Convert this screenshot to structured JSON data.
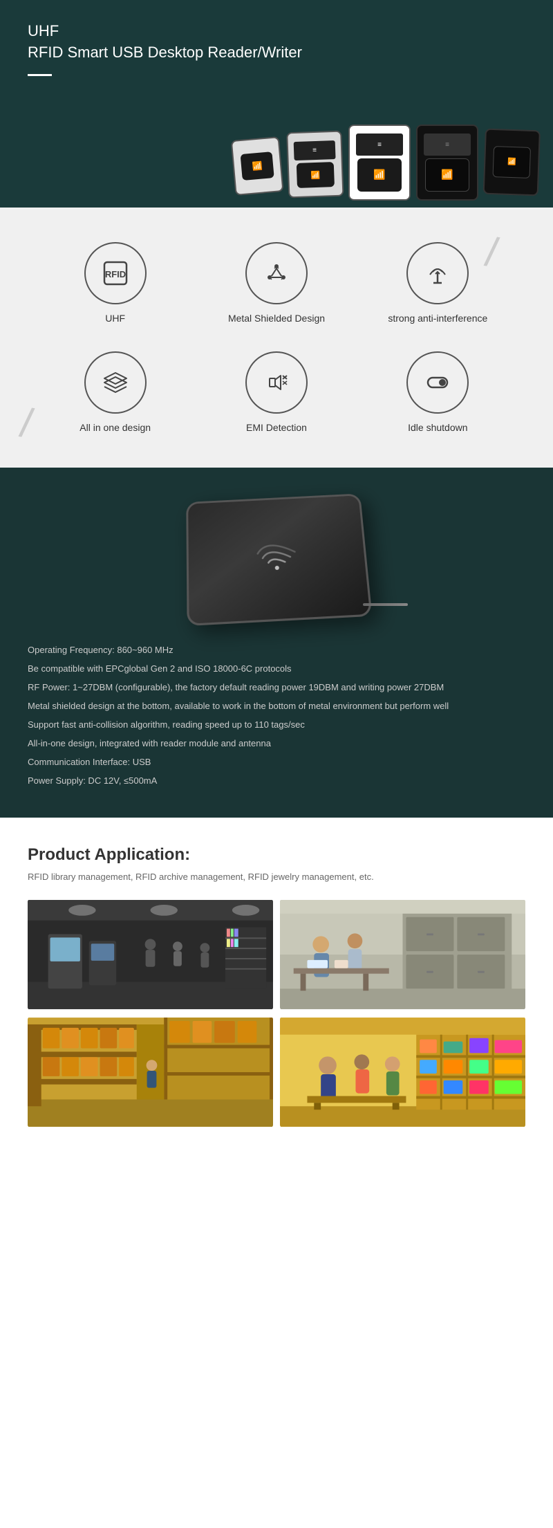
{
  "header": {
    "line1": "UHF",
    "line2": "RFID Smart USB Desktop Reader/Writer"
  },
  "features": {
    "row1": [
      {
        "id": "uhf",
        "label": "UHF",
        "icon": "rfid"
      },
      {
        "id": "metal-shield",
        "label": "Metal Shielded Design",
        "icon": "shield"
      },
      {
        "id": "anti-interference",
        "label": "strong anti-interference",
        "icon": "antenna"
      }
    ],
    "row2": [
      {
        "id": "all-in-one",
        "label": "All in one design",
        "icon": "layers"
      },
      {
        "id": "emi",
        "label": "EMI Detection",
        "icon": "emi"
      },
      {
        "id": "idle-shutdown",
        "label": "Idle shutdown",
        "icon": "toggle"
      }
    ]
  },
  "specs": {
    "items": [
      "Operating Frequency: 860~960 MHz",
      "Be compatible with EPCglobal Gen 2 and ISO 18000-6C protocols",
      "RF Power: 1~27DBM (configurable), the factory default reading power 19DBM and writing power 27DBM",
      "Metal shielded design at the bottom, available to work in the bottom of metal environment but perform well",
      "Support fast anti-collision algorithm, reading speed up to 110 tags/sec",
      "All-in-one design, integrated with reader module and antenna",
      "Communication Interface: USB",
      "Power Supply: DC 12V, ≤500mA"
    ]
  },
  "application": {
    "title": "Product Application:",
    "description": "RFID library management, RFID archive management, RFID jewelry management, etc.",
    "images": [
      {
        "id": "library",
        "alt": "Library management",
        "scene": "library"
      },
      {
        "id": "office",
        "alt": "Office management",
        "scene": "office"
      },
      {
        "id": "warehouse",
        "alt": "Warehouse management",
        "scene": "warehouse"
      },
      {
        "id": "retail",
        "alt": "Retail management",
        "scene": "retail"
      }
    ]
  }
}
